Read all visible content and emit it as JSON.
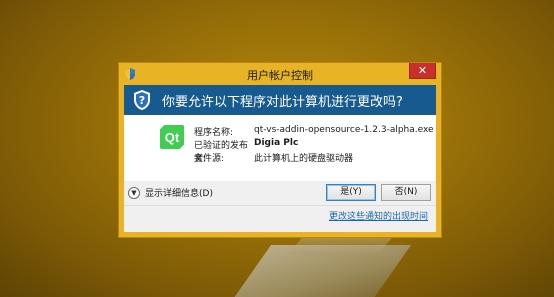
{
  "window": {
    "title": "用户帐户控制",
    "close_glyph": "✕"
  },
  "header": {
    "question": "你要允许以下程序对此计算机进行更改吗?"
  },
  "app": {
    "icon_text": "Qt",
    "rows": [
      {
        "label": "程序名称:",
        "value": "qt-vs-addin-opensource-1.2.3-alpha.exe"
      },
      {
        "label": "已验证的发布者:",
        "value": "Digia Plc"
      },
      {
        "label": "文件源:",
        "value": "此计算机上的硬盘驱动器"
      }
    ]
  },
  "footer": {
    "details_label": "显示详细信息(D)",
    "yes_label": "是(Y)",
    "no_label": "否(N)",
    "settings_link": "更改这些通知的出现时间"
  },
  "icons": [
    "shield-icon",
    "qt-app-icon",
    "chevron-down-icon",
    "close-icon"
  ],
  "colors": {
    "frame": "#e8b425",
    "header": "#165a8f",
    "close": "#c7302b",
    "link": "#1667b2",
    "qt_green": "#41cd52"
  }
}
